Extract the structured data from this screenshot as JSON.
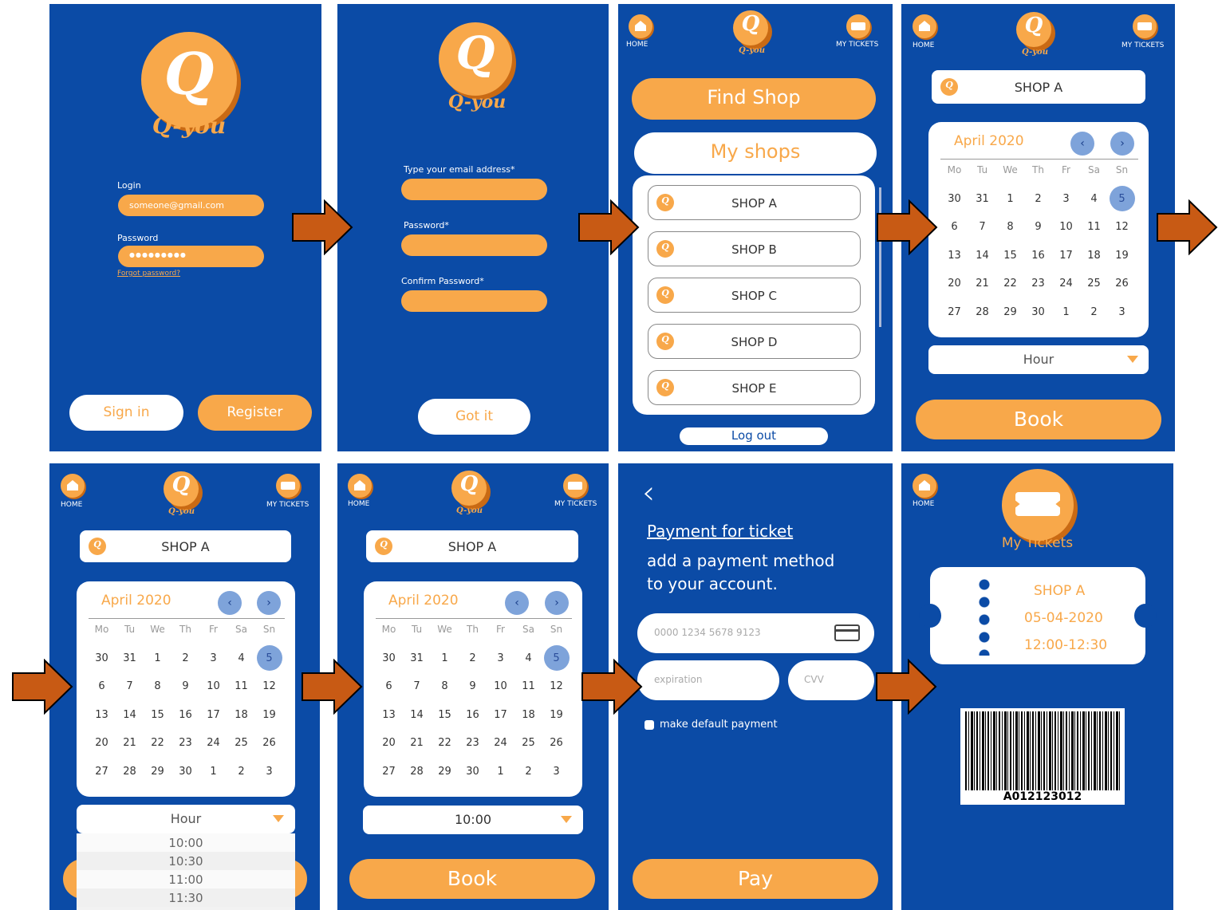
{
  "brand": {
    "logo_letter": "Q",
    "name": "Q-you"
  },
  "nav": {
    "home": "HOME",
    "tickets": "MY TICKETS"
  },
  "s1": {
    "login_label": "Login",
    "login_value": "someone@gmail.com",
    "password_label": "Password",
    "password_value": "●●●●●●●●●",
    "forgot": "Forgot password?",
    "signin": "Sign in",
    "register": "Register"
  },
  "s2": {
    "email_label": "Type your email address*",
    "password_label": "Password*",
    "confirm_label": "Confirm Password*",
    "got_it": "Got it"
  },
  "s3": {
    "find_shop": "Find Shop",
    "my_shops": "My shops",
    "shops": [
      "SHOP A",
      "SHOP B",
      "SHOP C",
      "SHOP D",
      "SHOP E"
    ],
    "logout": "Log out"
  },
  "calendar": {
    "shop": "SHOP A",
    "month": "April 2020",
    "prev": "‹",
    "next": "›",
    "weekdays": [
      "Mo",
      "Tu",
      "We",
      "Th",
      "Fr",
      "Sa",
      "Sn"
    ],
    "days": [
      [
        "30",
        "31",
        "1",
        "2",
        "3",
        "4",
        "5"
      ],
      [
        "6",
        "7",
        "8",
        "9",
        "10",
        "11",
        "12"
      ],
      [
        "13",
        "14",
        "15",
        "16",
        "17",
        "18",
        "19"
      ],
      [
        "20",
        "21",
        "22",
        "23",
        "24",
        "25",
        "26"
      ],
      [
        "27",
        "28",
        "29",
        "30",
        "1",
        "2",
        "3"
      ]
    ],
    "selected_day": "5",
    "hour_placeholder": "Hour",
    "book": "Book"
  },
  "s5": {
    "hour_options": [
      "10:00",
      "10:30",
      "11:00",
      "11:30"
    ]
  },
  "s6": {
    "hour_value": "10:00"
  },
  "s7": {
    "back": "‹",
    "title": "Payment for ticket",
    "subtitle_1": "add a payment method",
    "subtitle_2": "to your account.",
    "card_placeholder": "0000 1234 5678 9123",
    "expiration_placeholder": "expiration",
    "cvv_placeholder": "CVV",
    "default_payment": "make default payment",
    "pay": "Pay"
  },
  "s8": {
    "title": "My Tickets",
    "shop": "SHOP A",
    "date": "05-04-2020",
    "time": "12:00-12:30",
    "barcode": "A012123012"
  },
  "colors": {
    "background": "#0b4ba6",
    "accent": "#f8a84a",
    "arrow": "#c85a14"
  }
}
